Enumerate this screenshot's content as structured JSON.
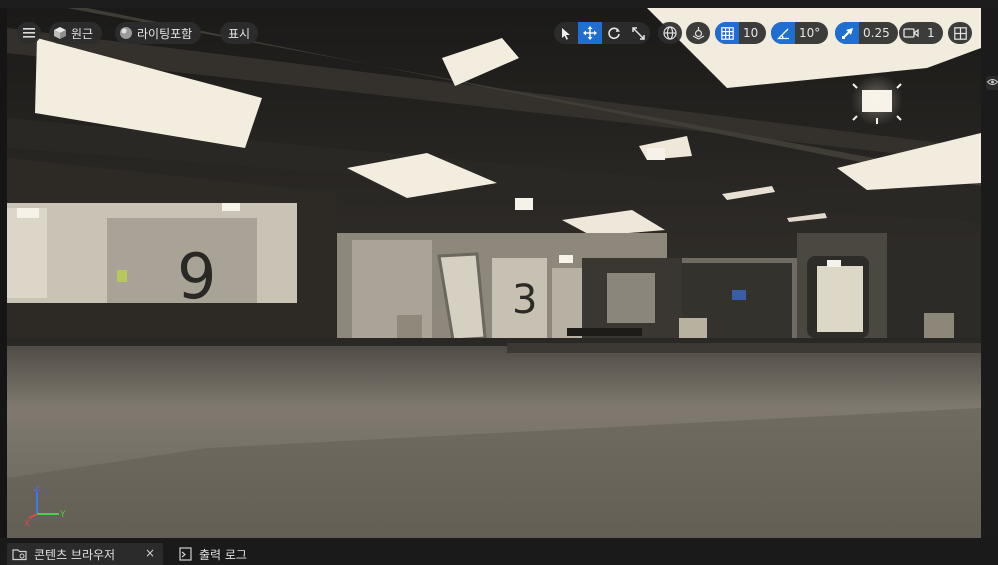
{
  "viewport": {
    "toolbar": {
      "menu_icon": "hamburger-icon",
      "perspective_label": "원근",
      "lighting_label": "라이팅포함",
      "show_label": "표시",
      "transform_tools": [
        "select-arrow-icon",
        "move-icon",
        "rotate-icon",
        "scale-icon"
      ],
      "active_tool": "move-icon",
      "grid_snap_value": "10",
      "rotation_snap_value": "10°",
      "scale_snap_value": "0.25",
      "camera_speed_value": "1"
    },
    "axis_labels": {
      "x": "X",
      "y": "Y",
      "z": "Z"
    },
    "colors": {
      "axis_x": "#e04646",
      "axis_y": "#46d046",
      "axis_z": "#3d7be6",
      "accent": "#1f6ed1"
    }
  },
  "bottom_tabs": [
    {
      "label": "콘텐츠 브라우저",
      "icon": "folder-icon",
      "close": "×"
    },
    {
      "label": "출력 로그",
      "icon": "output-log-icon"
    }
  ]
}
